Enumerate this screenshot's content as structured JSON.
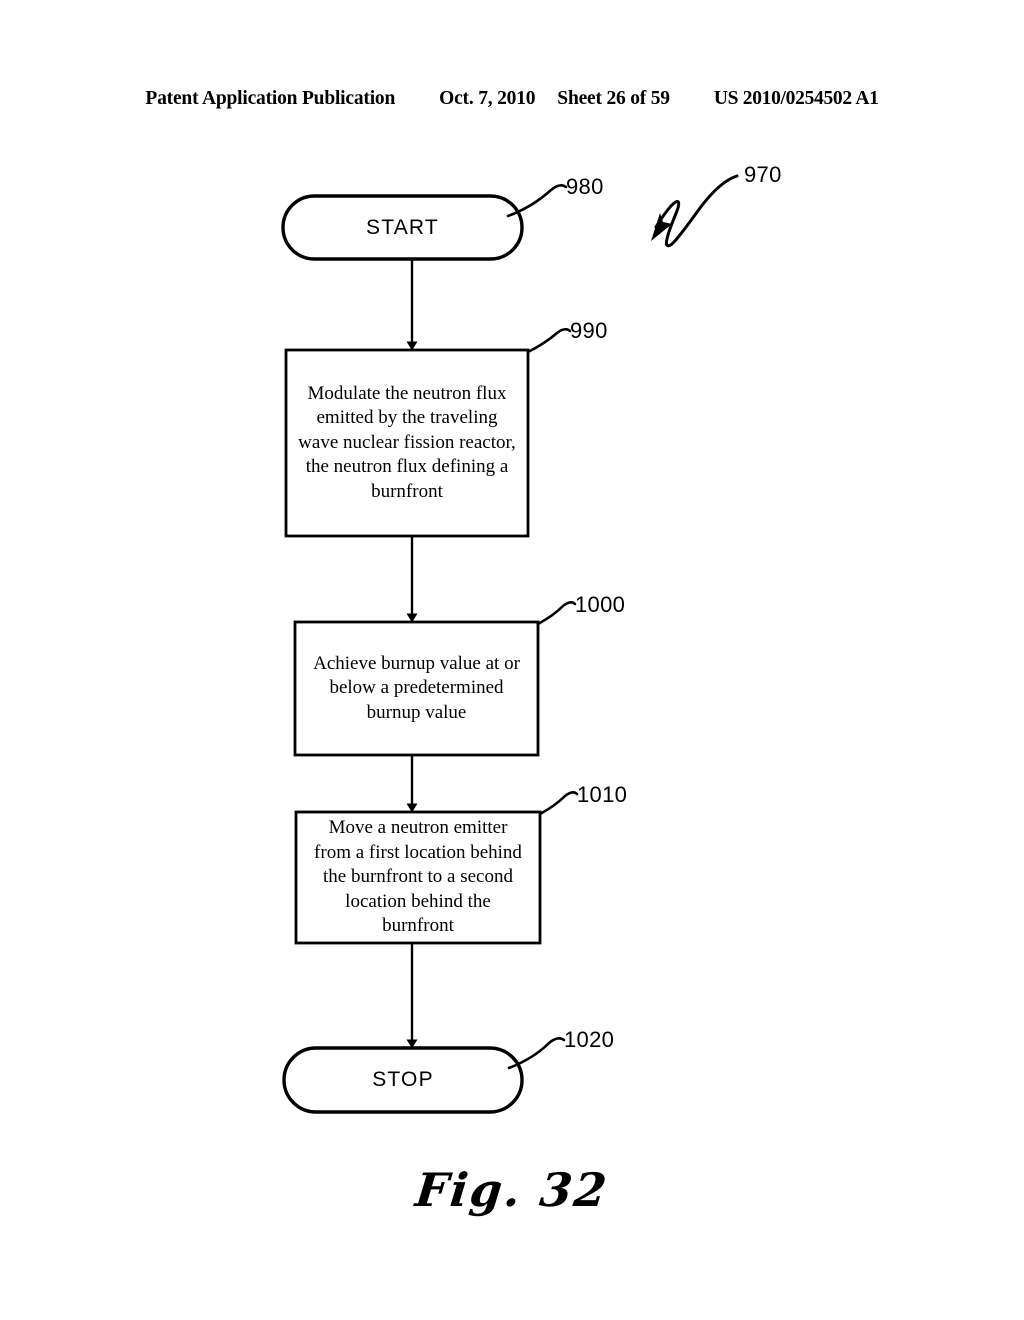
{
  "header": {
    "publication": "Patent Application Publication",
    "date": "Oct. 7, 2010",
    "sheet": "Sheet 26 of 59",
    "document_number": "US 2010/0254502 A1"
  },
  "figure": {
    "caption": "Fig. 32",
    "diagram_ref": "970"
  },
  "flowchart": {
    "start": {
      "label": "START",
      "ref": "980"
    },
    "steps": [
      {
        "ref": "990",
        "text": "Modulate the neutron flux emitted by the traveling wave nuclear fission reactor, the neutron flux defining a burnfront"
      },
      {
        "ref": "1000",
        "text": "Achieve burnup value at or below a predetermined burnup value"
      },
      {
        "ref": "1010",
        "text": "Move a neutron emitter from a first location behind the burnfront to a second location behind the burnfront"
      }
    ],
    "stop": {
      "label": "STOP",
      "ref": "1020"
    }
  },
  "colors": {
    "ink": "#000000",
    "page": "#ffffff"
  }
}
